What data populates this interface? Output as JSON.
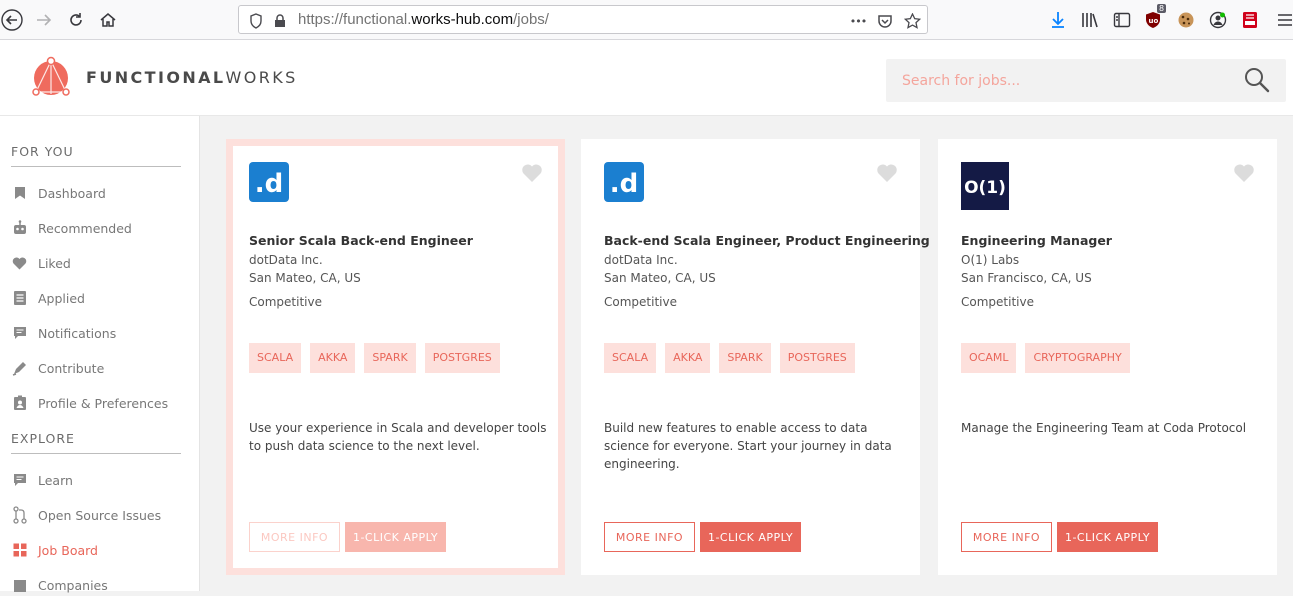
{
  "browser": {
    "url_prefix": "https://functional.",
    "url_host": "works-hub.com",
    "url_path": "/jobs/",
    "more_label": "•••",
    "ublock_badge": "8"
  },
  "header": {
    "brand_bold": "FUNCTIONAL",
    "brand_light": "WORKS",
    "search_placeholder": "Search for jobs..."
  },
  "sidebar": {
    "sections": [
      {
        "title": "FOR YOU"
      },
      {
        "title": "EXPLORE"
      }
    ],
    "items": [
      {
        "label": "Dashboard",
        "icon": "bookmark-icon"
      },
      {
        "label": "Recommended",
        "icon": "robot-icon"
      },
      {
        "label": "Liked",
        "icon": "heart-icon"
      },
      {
        "label": "Applied",
        "icon": "document-icon"
      },
      {
        "label": "Notifications",
        "icon": "chat-icon"
      },
      {
        "label": "Contribute",
        "icon": "pen-icon"
      },
      {
        "label": "Profile & Preferences",
        "icon": "profile-icon"
      },
      {
        "label": "Learn",
        "icon": "chat-icon"
      },
      {
        "label": "Open Source Issues",
        "icon": "git-icon"
      },
      {
        "label": "Job Board",
        "icon": "grid-icon"
      },
      {
        "label": "Companies",
        "icon": "building-icon"
      }
    ],
    "active_color": "#e8665a"
  },
  "jobs": [
    {
      "logo_text": ".d",
      "logo_color": "#1b7fd0",
      "title": "Senior Scala Back-end Engineer",
      "company": "dotData Inc.",
      "location": "San Mateo, CA, US",
      "salary": "Competitive",
      "tags": [
        "SCALA",
        "AKKA",
        "SPARK",
        "POSTGRES"
      ],
      "description": "Use your experience in Scala and developer tools to push data science to the next level.",
      "more_label": "MORE INFO",
      "apply_label": "1-CLICK APPLY"
    },
    {
      "logo_text": ".d",
      "logo_color": "#1b7fd0",
      "title": "Back-end Scala Engineer, Product Engineering",
      "company": "dotData Inc.",
      "location": "San Mateo, CA, US",
      "salary": "Competitive",
      "tags": [
        "SCALA",
        "AKKA",
        "SPARK",
        "POSTGRES"
      ],
      "description": "Build new features to enable access to data science for everyone. Start your journey in data engineering.",
      "more_label": "MORE INFO",
      "apply_label": "1-CLICK APPLY"
    },
    {
      "logo_text": "O(1)",
      "logo_color": "#141a45",
      "title": "Engineering Manager",
      "company": "O(1) Labs",
      "location": "San Francisco, CA, US",
      "salary": "Competitive",
      "tags": [
        "OCAML",
        "CRYPTOGRAPHY"
      ],
      "description": "Manage the Engineering Team at Coda Protocol",
      "more_label": "MORE INFO",
      "apply_label": "1-CLICK APPLY"
    }
  ]
}
